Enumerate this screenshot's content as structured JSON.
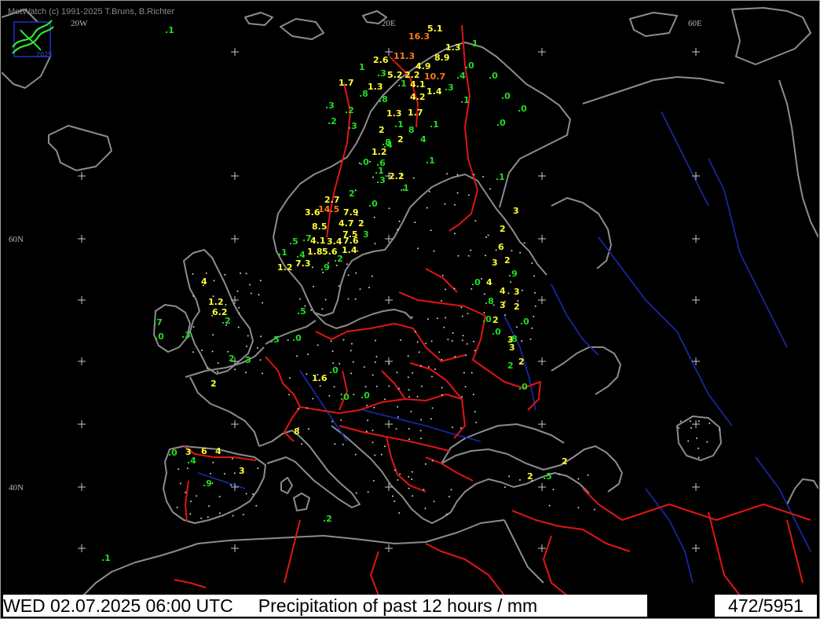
{
  "credit": "MetWatch  (c) 1991-2025 T.Bruns, B.Richter",
  "logo_text": "2025",
  "grid_labels": {
    "lon_20w": "20W",
    "lon_20e": "20E",
    "lon_60e": "60E",
    "lat_60n": "60N",
    "lat_40n": "40N"
  },
  "status": {
    "datetime": "WED 02.07.2025 06:00 UTC",
    "product": "Precipitation of past  12 hours  / mm",
    "count": "472/5951"
  },
  "colors": {
    "low": "#22dd22",
    "mid": "#ffff33",
    "high": "#ff7a1a",
    "coast": "#8c8c8c",
    "border": "#e01515",
    "river": "#1a2ab0"
  },
  "precip_values": [
    {
      "t": ".1",
      "c": "low"
    },
    {
      "t": "5.1",
      "c": "mid"
    },
    {
      "t": "16.3",
      "c": "high"
    },
    {
      "t": "1",
      "c": "low"
    },
    {
      "t": "1.3",
      "c": "mid"
    },
    {
      "t": "2.6",
      "c": "mid"
    },
    {
      "t": "11.3",
      "c": "high"
    },
    {
      "t": "8.9",
      "c": "mid"
    },
    {
      "t": ".0",
      "c": "low"
    },
    {
      "t": "4.9",
      "c": "mid"
    },
    {
      "t": "1",
      "c": "low"
    },
    {
      "t": ".3",
      "c": "low"
    },
    {
      "t": "5.2",
      "c": "mid"
    },
    {
      "t": "2.2",
      "c": "mid"
    },
    {
      "t": "10.7",
      "c": "high"
    },
    {
      "t": ".4",
      "c": "low"
    },
    {
      "t": ".0",
      "c": "low"
    },
    {
      "t": "1.7",
      "c": "mid"
    },
    {
      "t": ".1",
      "c": "low"
    },
    {
      "t": "1.3",
      "c": "mid"
    },
    {
      "t": "4.1",
      "c": "mid"
    },
    {
      "t": ".3",
      "c": "low"
    },
    {
      "t": ".8",
      "c": "low"
    },
    {
      "t": "4.2",
      "c": "mid"
    },
    {
      "t": "1.4",
      "c": "mid"
    },
    {
      "t": ".8",
      "c": "low"
    },
    {
      "t": ".1",
      "c": "low"
    },
    {
      "t": ".0",
      "c": "low"
    },
    {
      "t": ".3",
      "c": "low"
    },
    {
      "t": ".2",
      "c": "low"
    },
    {
      "t": "1.3",
      "c": "mid"
    },
    {
      "t": "1.7",
      "c": "mid"
    },
    {
      "t": ".0",
      "c": "low"
    },
    {
      "t": ".0",
      "c": "low"
    },
    {
      "t": ".2",
      "c": "low"
    },
    {
      "t": ".3",
      "c": "low"
    },
    {
      "t": "2",
      "c": "mid"
    },
    {
      "t": ".1",
      "c": "low"
    },
    {
      "t": "8",
      "c": "low"
    },
    {
      "t": ".1",
      "c": "low"
    },
    {
      "t": "2",
      "c": "mid"
    },
    {
      "t": ".4",
      "c": "low"
    },
    {
      "t": ".8",
      "c": "low"
    },
    {
      "t": "4",
      "c": "low"
    },
    {
      "t": "1.2",
      "c": "mid"
    },
    {
      "t": ".0",
      "c": "low"
    },
    {
      "t": ".6",
      "c": "low"
    },
    {
      "t": ".1",
      "c": "low"
    },
    {
      "t": ".1",
      "c": "low"
    },
    {
      "t": "2.2",
      "c": "mid"
    },
    {
      "t": ".3",
      "c": "low"
    },
    {
      "t": ".1",
      "c": "low"
    },
    {
      "t": ".1",
      "c": "low"
    },
    {
      "t": "2",
      "c": "low"
    },
    {
      "t": "2.7",
      "c": "mid"
    },
    {
      "t": ".0",
      "c": "low"
    },
    {
      "t": "3",
      "c": "mid"
    },
    {
      "t": "3.6",
      "c": "mid"
    },
    {
      "t": "14.5",
      "c": "high"
    },
    {
      "t": "7.9",
      "c": "mid"
    },
    {
      "t": "2",
      "c": "mid"
    },
    {
      "t": "4.7",
      "c": "mid"
    },
    {
      "t": "8.5",
      "c": "mid"
    },
    {
      "t": "7.5",
      "c": "mid"
    },
    {
      "t": "2",
      "c": "mid"
    },
    {
      "t": "3",
      "c": "low"
    },
    {
      "t": "4.1",
      "c": "mid"
    },
    {
      "t": "3.4",
      "c": "mid"
    },
    {
      "t": "7.6",
      "c": "mid"
    },
    {
      "t": ".7",
      "c": "low"
    },
    {
      "t": ".5",
      "c": "low"
    },
    {
      "t": "6",
      "c": "mid"
    },
    {
      "t": ".1",
      "c": "low"
    },
    {
      "t": "1.8",
      "c": "mid"
    },
    {
      "t": "5.6",
      "c": "mid"
    },
    {
      "t": "1.4",
      "c": "mid"
    },
    {
      "t": ".4",
      "c": "low"
    },
    {
      "t": ".2",
      "c": "low"
    },
    {
      "t": "7.3",
      "c": "mid"
    },
    {
      "t": "3",
      "c": "mid"
    },
    {
      "t": "2",
      "c": "mid"
    },
    {
      "t": "1.2",
      "c": "mid"
    },
    {
      "t": ".9",
      "c": "low"
    },
    {
      "t": ".9",
      "c": "low"
    },
    {
      "t": "4",
      "c": "mid"
    },
    {
      "t": ".0",
      "c": "low"
    },
    {
      "t": "4",
      "c": "mid"
    },
    {
      "t": "4",
      "c": "mid"
    },
    {
      "t": "3",
      "c": "mid"
    },
    {
      "t": "1.2",
      "c": "mid"
    },
    {
      "t": ".8",
      "c": "low"
    },
    {
      "t": "3",
      "c": "mid"
    },
    {
      "t": "2",
      "c": "mid"
    },
    {
      "t": "6.2",
      "c": "mid"
    },
    {
      "t": ".5",
      "c": "low"
    },
    {
      "t": ".0",
      "c": "low"
    },
    {
      "t": "2",
      "c": "mid"
    },
    {
      "t": ".0",
      "c": "low"
    },
    {
      "t": ".7",
      "c": "low"
    },
    {
      "t": ".2",
      "c": "low"
    },
    {
      "t": ".0",
      "c": "low"
    },
    {
      "t": "3",
      "c": "mid"
    },
    {
      "t": ".3",
      "c": "low"
    },
    {
      "t": ".5",
      "c": "low"
    },
    {
      "t": ".0",
      "c": "low"
    },
    {
      "t": ".8",
      "c": "low"
    },
    {
      "t": ".0",
      "c": "low"
    },
    {
      "t": "3",
      "c": "mid"
    },
    {
      "t": "2",
      "c": "low"
    },
    {
      "t": "2",
      "c": "low"
    },
    {
      "t": ".3",
      "c": "low"
    },
    {
      "t": "2",
      "c": "mid"
    },
    {
      "t": ".0",
      "c": "low"
    },
    {
      "t": "1.6",
      "c": "mid"
    },
    {
      "t": "2",
      "c": "mid"
    },
    {
      "t": ".0",
      "c": "low"
    },
    {
      "t": ".0",
      "c": "low"
    },
    {
      "t": "8",
      "c": "mid"
    },
    {
      "t": ".0",
      "c": "low"
    },
    {
      "t": "3",
      "c": "mid"
    },
    {
      "t": "6",
      "c": "mid"
    },
    {
      "t": "4",
      "c": "mid"
    },
    {
      "t": ".4",
      "c": "low"
    },
    {
      "t": "3",
      "c": "mid"
    },
    {
      "t": ".0",
      "c": "low"
    },
    {
      "t": ".9",
      "c": "low"
    },
    {
      "t": "2",
      "c": "mid"
    },
    {
      "t": "2",
      "c": "mid"
    },
    {
      "t": ".5",
      "c": "low"
    },
    {
      "t": ".2",
      "c": "low"
    },
    {
      "t": ".1",
      "c": "low"
    }
  ]
}
